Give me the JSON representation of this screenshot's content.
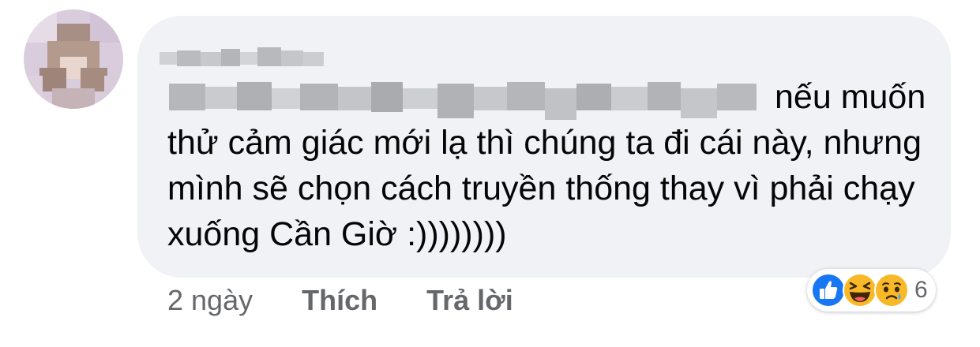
{
  "comment": {
    "author_name": "",
    "text": "nếu muốn thử cảm giác mới lạ thì chúng ta đi cái này, nhưng mình sẽ chọn cách truyền thống thay vì phải chạy xuống Cần Giờ :))))))))",
    "time": "2 ngày",
    "like_label": "Thích",
    "reply_label": "Trả lời"
  },
  "reactions": {
    "icons": [
      "like-icon",
      "haha-icon",
      "sad-icon"
    ],
    "count": "6"
  },
  "colors": {
    "bubble_bg": "#f0f2f5",
    "text": "#050505",
    "secondary_text": "#65676b",
    "like_blue": "#1877f2",
    "emoji_yellow": "#f7b928"
  }
}
